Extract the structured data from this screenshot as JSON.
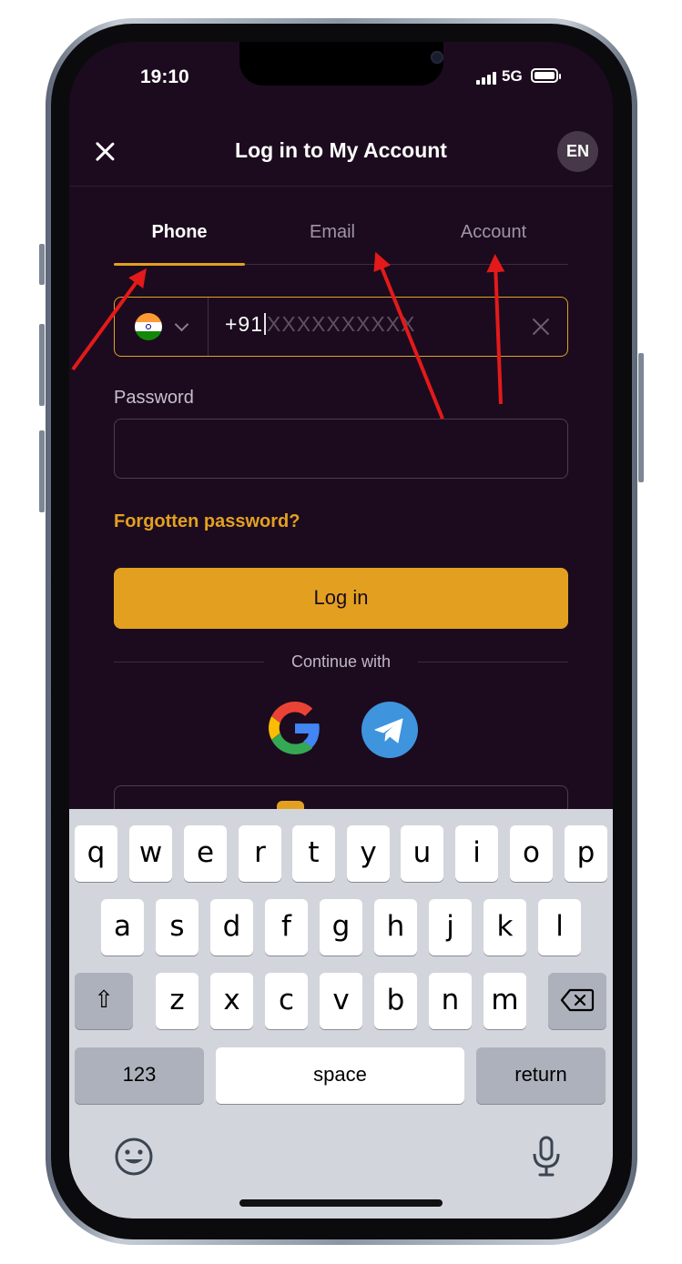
{
  "status": {
    "time": "19:10",
    "network": "5G"
  },
  "header": {
    "title": "Log in to My Account",
    "language": "EN"
  },
  "tabs": [
    {
      "label": "Phone",
      "active": true
    },
    {
      "label": "Email",
      "active": false
    },
    {
      "label": "Account",
      "active": false
    }
  ],
  "phone": {
    "prefix": "+91",
    "placeholder": "XXXXXXXXXX",
    "country": "India"
  },
  "password": {
    "label": "Password",
    "value": ""
  },
  "forgot_label": "Forgotten password?",
  "login_label": "Log in",
  "continue_label": "Continue with",
  "social": [
    "google-icon",
    "telegram-icon"
  ],
  "keyboard": {
    "row1": [
      "q",
      "w",
      "e",
      "r",
      "t",
      "y",
      "u",
      "i",
      "o",
      "p"
    ],
    "row2": [
      "a",
      "s",
      "d",
      "f",
      "g",
      "h",
      "j",
      "k",
      "l"
    ],
    "row3": [
      "z",
      "x",
      "c",
      "v",
      "b",
      "n",
      "m"
    ],
    "shift": "⇧",
    "numbers": "123",
    "space": "space",
    "return": "return"
  },
  "colors": {
    "accent": "#e3a020",
    "background": "#1c0b1e",
    "annotation": "#e31a1a"
  }
}
